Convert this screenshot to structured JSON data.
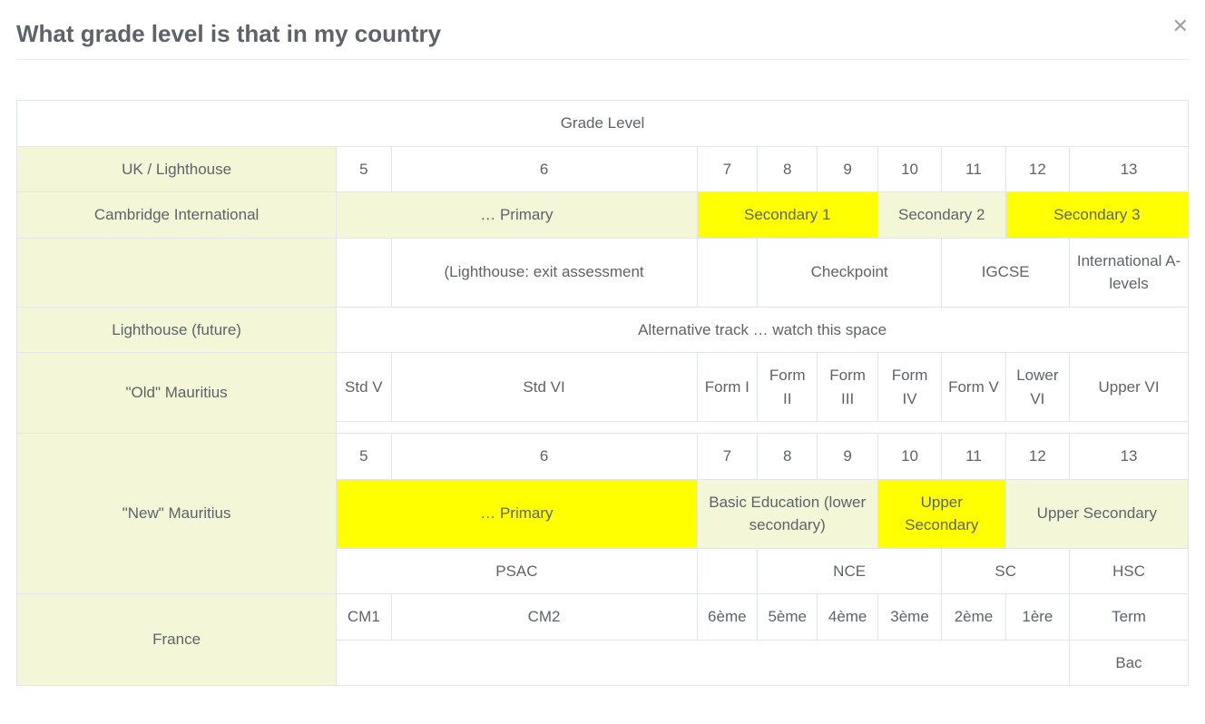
{
  "title": "What grade level is that in my country",
  "header_row": "Grade Level",
  "rows": {
    "uk": {
      "label": "UK / Lighthouse",
      "cells": [
        "5",
        "6",
        "7",
        "8",
        "9",
        "10",
        "11",
        "12",
        "13"
      ]
    },
    "cambridge": {
      "label": "Cambridge International",
      "primary": "… Primary",
      "sec1": "Secondary 1",
      "sec2": "Secondary 2",
      "sec3": "Secondary 3",
      "exit": "(Lighthouse: exit assessment",
      "checkpoint": "Checkpoint",
      "igcse": "IGCSE",
      "alevels": "International A-levels"
    },
    "future": {
      "label": "Lighthouse (future)",
      "note": "Alternative track … watch this space"
    },
    "old_mau": {
      "label": "\"Old\" Mauritius",
      "cells": [
        "Std V",
        "Std VI",
        "Form I",
        "Form II",
        "Form III",
        "Form IV",
        "Form V",
        "Lower VI",
        "Upper VI"
      ]
    },
    "new_mau": {
      "label": "\"New\" Mauritius",
      "grades": [
        "5",
        "6",
        "7",
        "8",
        "9",
        "10",
        "11",
        "12",
        "13"
      ],
      "primary": "… Primary",
      "basic": "Basic Education (lower secondary)",
      "upper_sec": "Upper Secondary",
      "upper_sec2": "Upper Secondary",
      "psac": "PSAC",
      "nce": "NCE",
      "sc": "SC",
      "hsc": "HSC"
    },
    "france": {
      "label": "France",
      "cells": [
        "CM1",
        "CM2",
        "6ème",
        "5ème",
        "4ème",
        "3ème",
        "2ème",
        "1ère",
        "Term"
      ],
      "bac": "Bac"
    }
  }
}
